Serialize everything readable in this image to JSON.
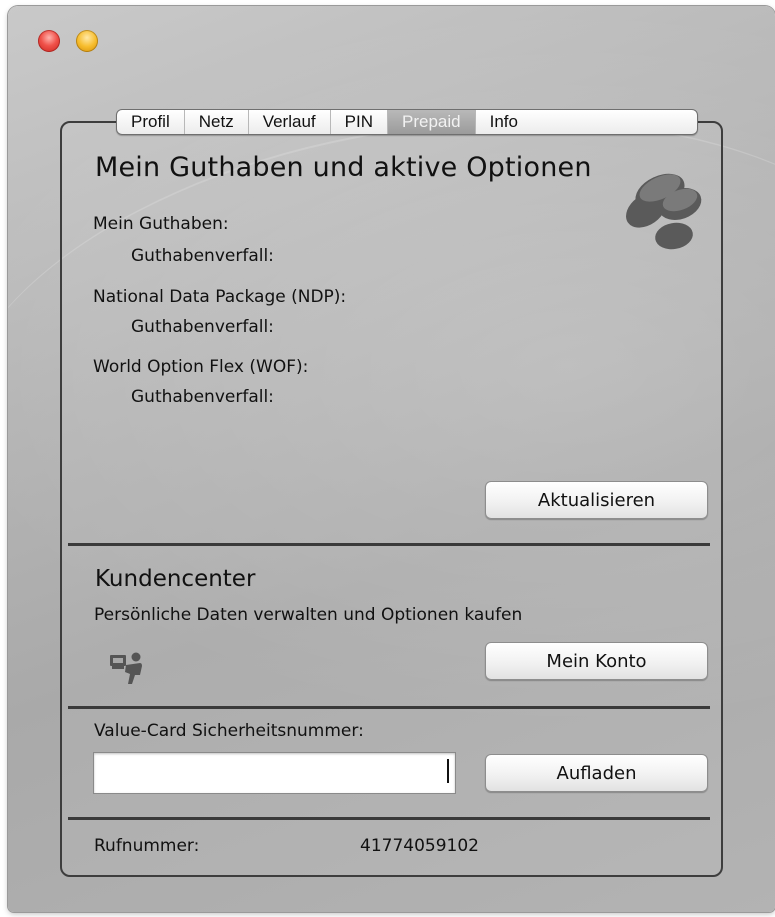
{
  "window": {
    "controls": {
      "close": "close-icon",
      "minimize": "minimize-icon"
    }
  },
  "tabs": [
    {
      "label": "Profil",
      "active": false
    },
    {
      "label": "Netz",
      "active": false
    },
    {
      "label": "Verlauf",
      "active": false
    },
    {
      "label": "PIN",
      "active": false
    },
    {
      "label": "Prepaid",
      "active": true
    },
    {
      "label": "Info",
      "active": false
    }
  ],
  "balance": {
    "heading": "Mein Guthaben und aktive Optionen",
    "icon": "coins-icon",
    "rows": [
      {
        "label": "Mein Guthaben:",
        "expiry_label": "Guthabenverfall:"
      },
      {
        "label": "National Data Package (NDP):",
        "expiry_label": "Guthabenverfall:"
      },
      {
        "label": "World Option Flex (WOF):",
        "expiry_label": "Guthabenverfall:"
      }
    ],
    "refresh_button": "Aktualisieren"
  },
  "customer_center": {
    "title": "Kundencenter",
    "description": "Persönliche Daten verwalten und Optionen kaufen",
    "icon": "user-desk-icon",
    "account_button": "Mein Konto"
  },
  "topup": {
    "label": "Value-Card Sicherheitsnummer:",
    "input_value": "",
    "button": "Aufladen"
  },
  "phone": {
    "label": "Rufnummer:",
    "value": "41774059102"
  }
}
